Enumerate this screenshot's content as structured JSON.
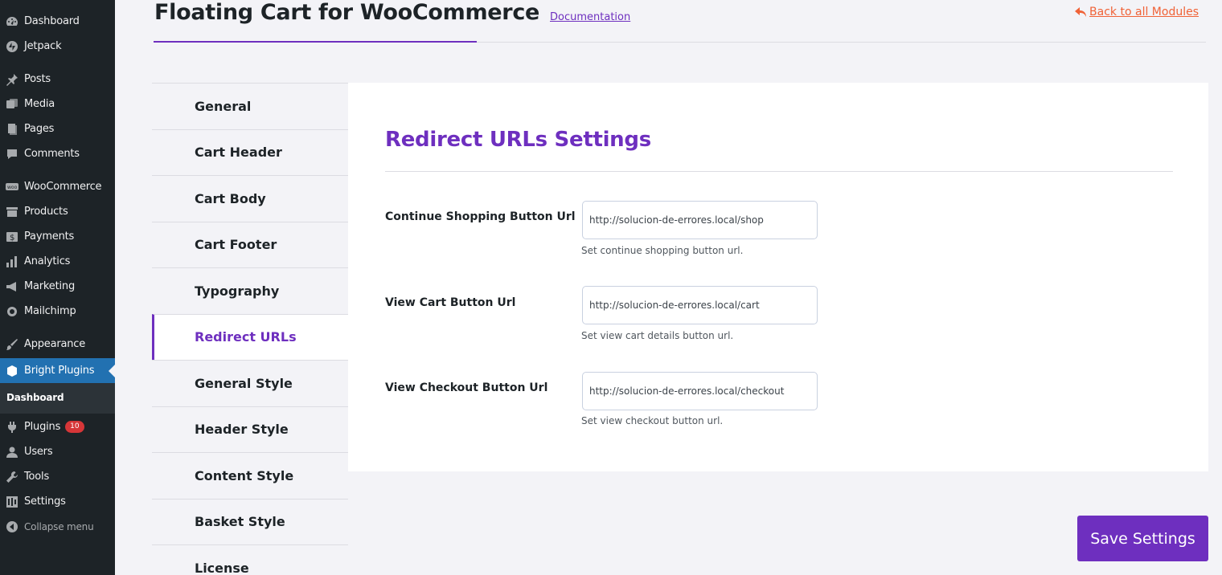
{
  "sidebar": {
    "items": [
      {
        "label": "Dashboard",
        "icon": "dashboard-icon"
      },
      {
        "label": "Jetpack",
        "icon": "jetpack-icon"
      },
      {
        "label": "Posts",
        "icon": "pin-icon"
      },
      {
        "label": "Media",
        "icon": "media-icon"
      },
      {
        "label": "Pages",
        "icon": "pages-icon"
      },
      {
        "label": "Comments",
        "icon": "comment-icon"
      },
      {
        "label": "WooCommerce",
        "icon": "woo-icon"
      },
      {
        "label": "Products",
        "icon": "archive-icon"
      },
      {
        "label": "Payments",
        "icon": "dollar-icon"
      },
      {
        "label": "Analytics",
        "icon": "bar-chart-icon"
      },
      {
        "label": "Marketing",
        "icon": "megaphone-icon"
      },
      {
        "label": "Mailchimp",
        "icon": "mailchimp-icon"
      },
      {
        "label": "Appearance",
        "icon": "brush-icon"
      },
      {
        "label": "Bright Plugins",
        "icon": "bright-plugins-icon"
      },
      {
        "label": "Plugins",
        "icon": "plug-icon",
        "badge": "10"
      },
      {
        "label": "Users",
        "icon": "user-icon"
      },
      {
        "label": "Tools",
        "icon": "wrench-icon"
      },
      {
        "label": "Settings",
        "icon": "settings-icon"
      },
      {
        "label": "Collapse menu",
        "icon": "collapse-icon"
      }
    ],
    "submenu_label": "Dashboard"
  },
  "header": {
    "title": "Floating Cart for WooCommerce",
    "doc_link": "Documentation",
    "back_link": "Back to all Modules"
  },
  "tabs": [
    {
      "label": "General"
    },
    {
      "label": "Cart Header"
    },
    {
      "label": "Cart Body"
    },
    {
      "label": "Cart Footer"
    },
    {
      "label": "Typography"
    },
    {
      "label": "Redirect URLs",
      "active": true
    },
    {
      "label": "General Style"
    },
    {
      "label": "Header Style"
    },
    {
      "label": "Content Style"
    },
    {
      "label": "Basket Style"
    },
    {
      "label": "License"
    }
  ],
  "panel": {
    "title": "Redirect URLs Settings",
    "fields": [
      {
        "label": "Continue Shopping Button Url",
        "value": "http://solucion-de-errores.local/shop",
        "help": "Set continue shopping button url."
      },
      {
        "label": "View Cart Button Url",
        "value": "http://solucion-de-errores.local/cart",
        "help": "Set view cart details button url."
      },
      {
        "label": "View Checkout Button Url",
        "value": "http://solucion-de-errores.local/checkout",
        "help": "Set view checkout button url."
      }
    ]
  },
  "save_label": "Save Settings",
  "colors": {
    "accent": "#6e2fbf",
    "sidebar": "#1d2327",
    "current": "#2271b1",
    "back_link": "#f06237"
  }
}
